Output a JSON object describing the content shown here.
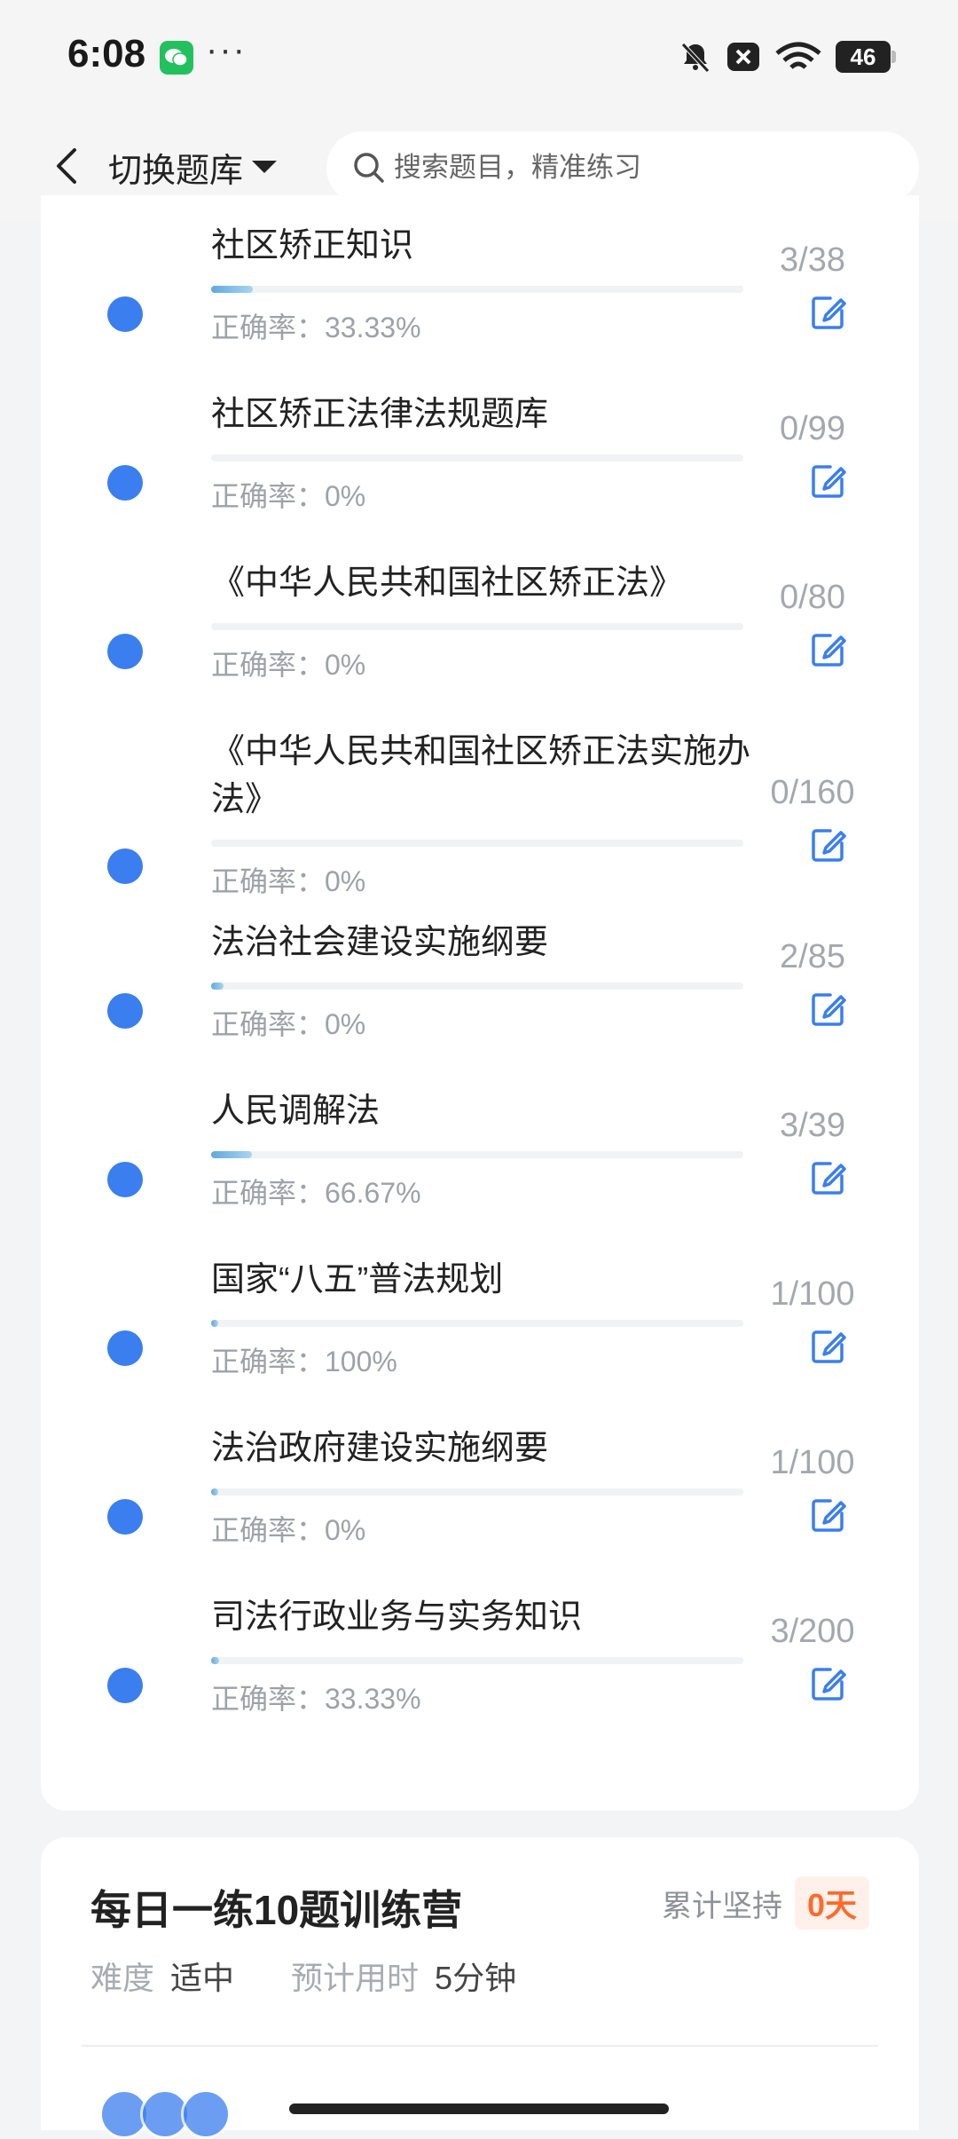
{
  "status_bar": {
    "time": "6:08",
    "dots": "···",
    "battery": "46"
  },
  "nav": {
    "bank_switch_label": "切换题库",
    "search_placeholder": "搜索题目，精准练习"
  },
  "items": [
    {
      "title": "社区矫正知识",
      "progress": 0.079,
      "accuracy": "正确率：33.33%",
      "count": "3/38"
    },
    {
      "title": "社区矫正法律法规题库",
      "progress": 0,
      "accuracy": "正确率：0%",
      "count": "0/99"
    },
    {
      "title": "《中华人民共和国社区矫正法》",
      "progress": 0,
      "accuracy": "正确率：0%",
      "count": "0/80"
    },
    {
      "title": "《中华人民共和国社区矫正法实施办法》",
      "progress": 0,
      "accuracy": "正确率：0%",
      "count": "0/160"
    },
    {
      "title": "法治社会建设实施纲要",
      "progress": 0.024,
      "accuracy": "正确率：0%",
      "count": "2/85"
    },
    {
      "title": "人民调解法",
      "progress": 0.077,
      "accuracy": "正确率：66.67%",
      "count": "3/39"
    },
    {
      "title": "国家“八五”普法规划",
      "progress": 0.01,
      "accuracy": "正确率：100%",
      "count": "1/100"
    },
    {
      "title": "法治政府建设实施纲要",
      "progress": 0.01,
      "accuracy": "正确率：0%",
      "count": "1/100"
    },
    {
      "title": "司法行政业务与实务知识",
      "progress": 0.015,
      "accuracy": "正确率：33.33%",
      "count": "3/200"
    }
  ],
  "daily": {
    "title": "每日一练10题训练营",
    "streak_label": "累计坚持",
    "streak_value": "0天",
    "difficulty_label": "难度",
    "difficulty_value": "适中",
    "time_label": "预计用时",
    "time_value": "5分钟"
  },
  "colors": {
    "accent": "#3a7ef0",
    "streak": "#ff6a2b"
  }
}
